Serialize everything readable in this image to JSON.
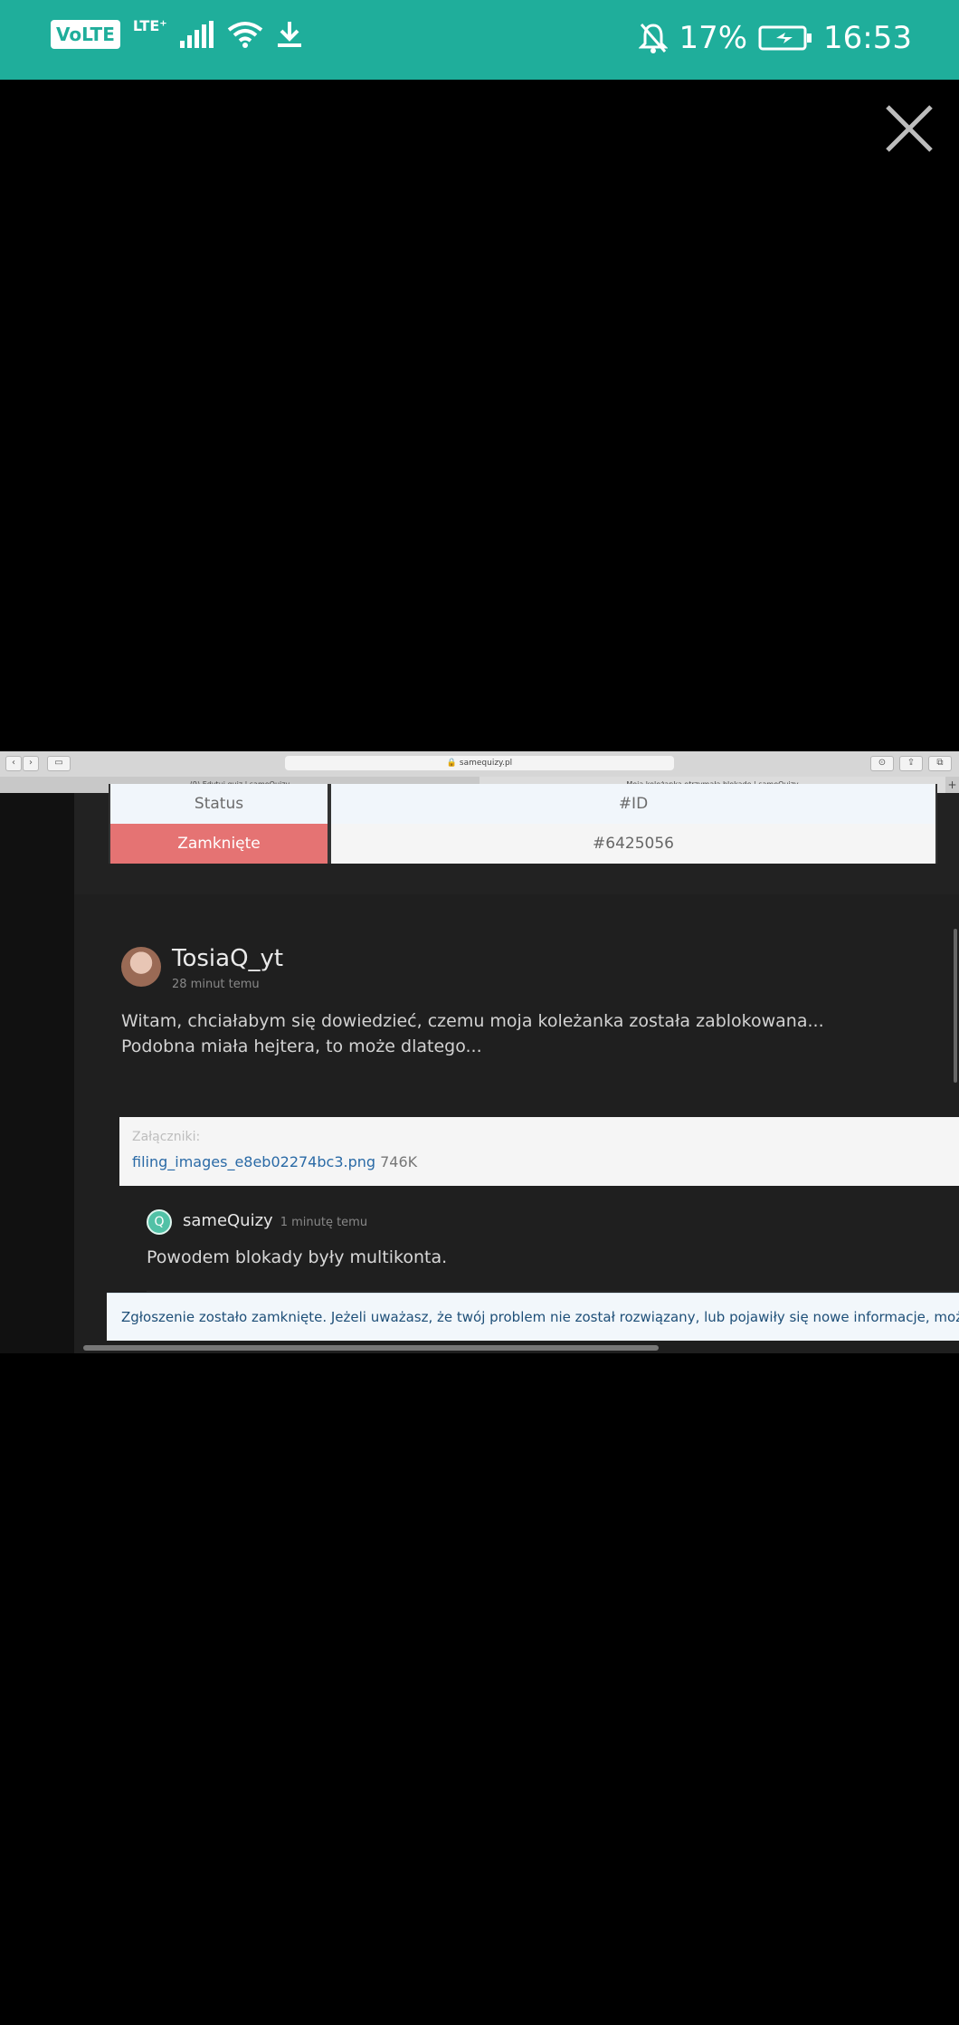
{
  "status_bar": {
    "volte": "VoLTE",
    "lte": "LTE⁺",
    "battery": "17%",
    "time": "16:53",
    "icons": [
      "signal-icon",
      "wifi-icon",
      "download-icon",
      "bell-off-icon",
      "battery-charging-icon"
    ]
  },
  "viewer": {
    "close_icon": "close-icon"
  },
  "browser": {
    "url": "🔒 samequizy.pl",
    "tabs": [
      {
        "label": "(9) Edytuj quiz | sameQuizy"
      },
      {
        "label": "Moja koleżanka otrzymała blokadę | sameQuizy"
      }
    ]
  },
  "ticket": {
    "status_header": "Status",
    "id_header": "#ID",
    "status_value": "Zamknięte",
    "id_value": "#6425056",
    "status_color": "#e57373"
  },
  "post": {
    "author": "TosiaQ_yt",
    "time": "28 minut temu",
    "body_line1": "Witam, chciałabym się dowiedzieć, czemu moja koleżanka została zablokowana...",
    "body_line2": "Podobna miała hejtera, to może dlatego...",
    "attachments_label": "Załączniki:",
    "attachment_name": "filing_images_e8eb02274bc3.png",
    "attachment_size": "746K"
  },
  "reply": {
    "author": "sameQuizy",
    "time": "1 minutę temu",
    "text": "Powodem blokady były multikonta."
  },
  "notice": {
    "text": "Zgłoszenie zostało zamknięte. Jeżeli uważasz, że twój problem nie został rozwiązany, lub pojawiły się nowe informacje, możesz ponownie"
  }
}
